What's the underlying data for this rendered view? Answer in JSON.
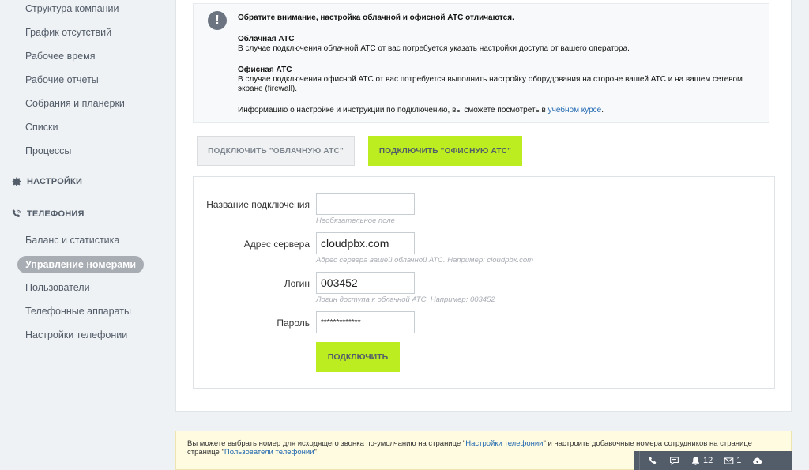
{
  "sidebar": {
    "items_top": [
      {
        "label": "Структура компании"
      },
      {
        "label": "График отсутствий"
      },
      {
        "label": "Рабочее время"
      },
      {
        "label": "Рабочие отчеты"
      },
      {
        "label": "Собрания и планерки"
      },
      {
        "label": "Списки"
      },
      {
        "label": "Процессы"
      }
    ],
    "section_settings": "НАСТРОЙКИ",
    "section_telephony": "ТЕЛЕФОНИЯ",
    "telephony_items": [
      {
        "label": "Баланс и статистика"
      },
      {
        "label": "Управление номерами",
        "active": true
      },
      {
        "label": "Пользователи"
      },
      {
        "label": "Телефонные аппараты"
      },
      {
        "label": "Настройки телефонии"
      }
    ]
  },
  "notice": {
    "icon": "exclamation-icon",
    "heading": "Обратите внимание, настройка облачной и офисной АТС отличаются.",
    "cloud_title": "Облачная АТС",
    "cloud_text": "В случае подключения облачной АТС от вас потребуется указать настройки доступа от вашего оператора.",
    "office_title": "Офисная АТС",
    "office_text": "В случае подключения офисной АТС от вас потребуется выполнить настройку оборудования на стороне вашей АТС и на вашем сетевом экране (firewall).",
    "info_text": "Информацию о настройке и инструкции по подключению, вы сможете посмотреть в",
    "info_link": "учебном курсе",
    "info_end": "."
  },
  "tabs": {
    "cloud": "ПОДКЛЮЧИТЬ \"ОБЛАЧНУЮ АТС\"",
    "office": "ПОДКЛЮЧИТЬ \"ОФИСНУЮ АТС\""
  },
  "form": {
    "name_label": "Название подключения",
    "name_value": "",
    "name_hint": "Необязательное поле",
    "server_label": "Адрес сервера",
    "server_value": "cloudpbx.com",
    "server_hint": "Адрес сервера вашей облачной АТС. Например: cloudpbx.com",
    "login_label": "Логин",
    "login_value": "003452",
    "login_hint": "Логин доступа к облачной АТС. Например: 003452",
    "password_label": "Пароль",
    "password_value": "*************",
    "connect_button": "ПОДКЛЮЧИТЬ"
  },
  "infobar": {
    "text1": "Вы можете выбрать номер для исходящего звонка по-умолчанию на странице \"",
    "link1": "Настройки телефонии",
    "text2": "\" и настроить добавочные номера сотрудников на странице странице \"",
    "link2": "Пользователи телефонии",
    "text3": "\""
  },
  "taskbar": {
    "notifications_count": "12",
    "messages_count": "1"
  },
  "colors": {
    "accent_green": "#bbed21",
    "link_blue": "#2067b0",
    "sidebar_active": "#a8adb4"
  }
}
